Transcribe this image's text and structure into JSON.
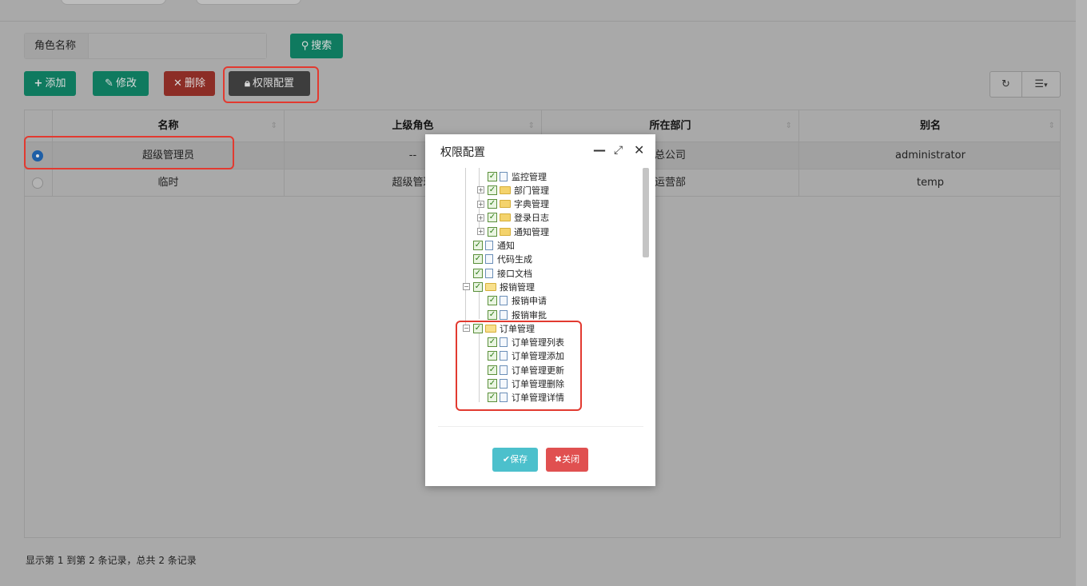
{
  "search": {
    "label": "角色名称",
    "value": "",
    "button": "搜索"
  },
  "toolbar": {
    "add": "添加",
    "edit": "修改",
    "delete": "删除",
    "permission": "权限配置"
  },
  "table": {
    "columns": [
      "名称",
      "上级角色",
      "所在部门",
      "别名"
    ],
    "rows": [
      {
        "name": "超级管理员",
        "parent": "--",
        "dept": "总公司",
        "alias": "administrator",
        "selected": true
      },
      {
        "name": "临时",
        "parent": "超级管理",
        "dept": "运营部",
        "alias": "temp",
        "selected": false
      }
    ]
  },
  "footer": {
    "summary": "显示第 1 到第 2 条记录，总共 2 条记录"
  },
  "modal": {
    "title": "权限配置",
    "save": "保存",
    "close": "关闭",
    "tree": [
      {
        "label": "监控管理",
        "type": "file",
        "level": 2
      },
      {
        "label": "部门管理",
        "type": "folder",
        "level": 2
      },
      {
        "label": "字典管理",
        "type": "folder",
        "level": 2
      },
      {
        "label": "登录日志",
        "type": "folder",
        "level": 2
      },
      {
        "label": "通知管理",
        "type": "folder",
        "level": 2
      },
      {
        "label": "通知",
        "type": "file",
        "level": 1
      },
      {
        "label": "代码生成",
        "type": "file",
        "level": 1
      },
      {
        "label": "接口文档",
        "type": "file",
        "level": 1
      },
      {
        "label": "报销管理",
        "type": "folder-open",
        "level": 1
      },
      {
        "label": "报销申请",
        "type": "file",
        "level": 2
      },
      {
        "label": "报销审批",
        "type": "file",
        "level": 2
      },
      {
        "label": "订单管理",
        "type": "folder-open",
        "level": 1
      },
      {
        "label": "订单管理列表",
        "type": "file",
        "level": 2
      },
      {
        "label": "订单管理添加",
        "type": "file",
        "level": 2
      },
      {
        "label": "订单管理更新",
        "type": "file",
        "level": 2
      },
      {
        "label": "订单管理删除",
        "type": "file",
        "level": 2
      },
      {
        "label": "订单管理详情",
        "type": "file",
        "level": 2
      }
    ]
  },
  "colors": {
    "accent_green": "#1ab394",
    "danger_red": "#ed5565",
    "highlight_box": "#e23a30",
    "save_button": "#4cc0cc"
  }
}
